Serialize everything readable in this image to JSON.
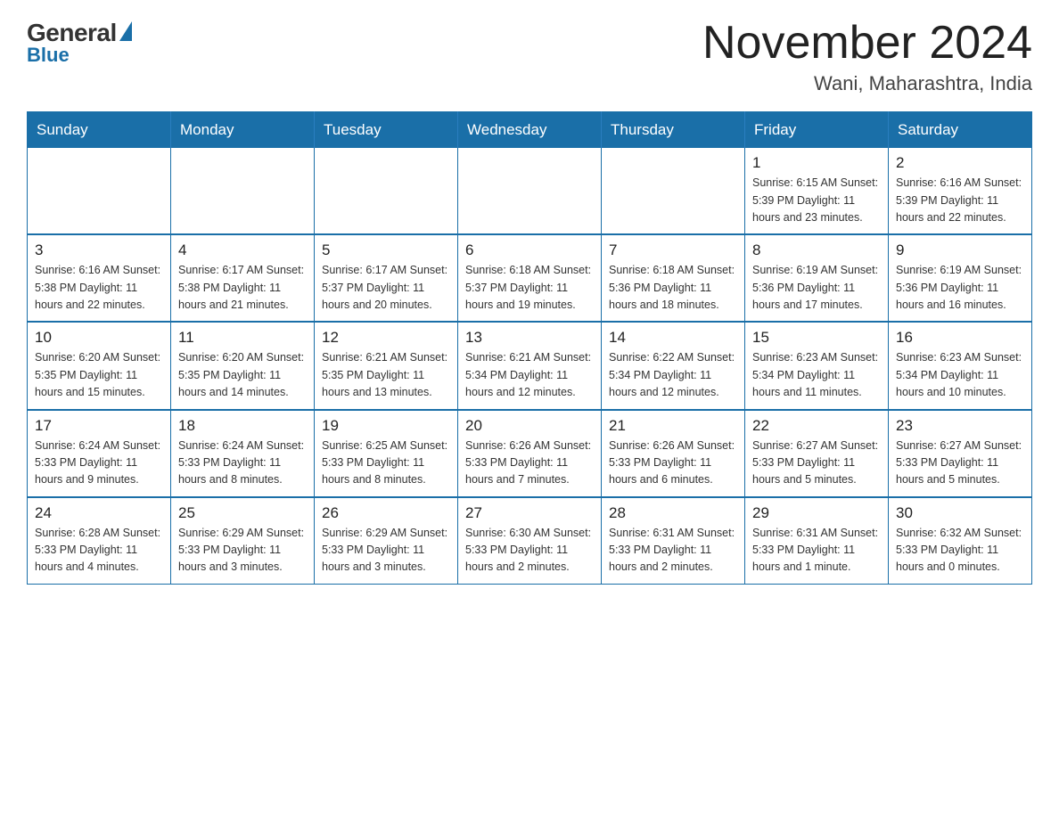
{
  "header": {
    "logo_general": "General",
    "logo_blue": "Blue",
    "month_year": "November 2024",
    "location": "Wani, Maharashtra, India"
  },
  "weekdays": [
    "Sunday",
    "Monday",
    "Tuesday",
    "Wednesday",
    "Thursday",
    "Friday",
    "Saturday"
  ],
  "weeks": [
    [
      {
        "day": "",
        "info": ""
      },
      {
        "day": "",
        "info": ""
      },
      {
        "day": "",
        "info": ""
      },
      {
        "day": "",
        "info": ""
      },
      {
        "day": "",
        "info": ""
      },
      {
        "day": "1",
        "info": "Sunrise: 6:15 AM\nSunset: 5:39 PM\nDaylight: 11 hours\nand 23 minutes."
      },
      {
        "day": "2",
        "info": "Sunrise: 6:16 AM\nSunset: 5:39 PM\nDaylight: 11 hours\nand 22 minutes."
      }
    ],
    [
      {
        "day": "3",
        "info": "Sunrise: 6:16 AM\nSunset: 5:38 PM\nDaylight: 11 hours\nand 22 minutes."
      },
      {
        "day": "4",
        "info": "Sunrise: 6:17 AM\nSunset: 5:38 PM\nDaylight: 11 hours\nand 21 minutes."
      },
      {
        "day": "5",
        "info": "Sunrise: 6:17 AM\nSunset: 5:37 PM\nDaylight: 11 hours\nand 20 minutes."
      },
      {
        "day": "6",
        "info": "Sunrise: 6:18 AM\nSunset: 5:37 PM\nDaylight: 11 hours\nand 19 minutes."
      },
      {
        "day": "7",
        "info": "Sunrise: 6:18 AM\nSunset: 5:36 PM\nDaylight: 11 hours\nand 18 minutes."
      },
      {
        "day": "8",
        "info": "Sunrise: 6:19 AM\nSunset: 5:36 PM\nDaylight: 11 hours\nand 17 minutes."
      },
      {
        "day": "9",
        "info": "Sunrise: 6:19 AM\nSunset: 5:36 PM\nDaylight: 11 hours\nand 16 minutes."
      }
    ],
    [
      {
        "day": "10",
        "info": "Sunrise: 6:20 AM\nSunset: 5:35 PM\nDaylight: 11 hours\nand 15 minutes."
      },
      {
        "day": "11",
        "info": "Sunrise: 6:20 AM\nSunset: 5:35 PM\nDaylight: 11 hours\nand 14 minutes."
      },
      {
        "day": "12",
        "info": "Sunrise: 6:21 AM\nSunset: 5:35 PM\nDaylight: 11 hours\nand 13 minutes."
      },
      {
        "day": "13",
        "info": "Sunrise: 6:21 AM\nSunset: 5:34 PM\nDaylight: 11 hours\nand 12 minutes."
      },
      {
        "day": "14",
        "info": "Sunrise: 6:22 AM\nSunset: 5:34 PM\nDaylight: 11 hours\nand 12 minutes."
      },
      {
        "day": "15",
        "info": "Sunrise: 6:23 AM\nSunset: 5:34 PM\nDaylight: 11 hours\nand 11 minutes."
      },
      {
        "day": "16",
        "info": "Sunrise: 6:23 AM\nSunset: 5:34 PM\nDaylight: 11 hours\nand 10 minutes."
      }
    ],
    [
      {
        "day": "17",
        "info": "Sunrise: 6:24 AM\nSunset: 5:33 PM\nDaylight: 11 hours\nand 9 minutes."
      },
      {
        "day": "18",
        "info": "Sunrise: 6:24 AM\nSunset: 5:33 PM\nDaylight: 11 hours\nand 8 minutes."
      },
      {
        "day": "19",
        "info": "Sunrise: 6:25 AM\nSunset: 5:33 PM\nDaylight: 11 hours\nand 8 minutes."
      },
      {
        "day": "20",
        "info": "Sunrise: 6:26 AM\nSunset: 5:33 PM\nDaylight: 11 hours\nand 7 minutes."
      },
      {
        "day": "21",
        "info": "Sunrise: 6:26 AM\nSunset: 5:33 PM\nDaylight: 11 hours\nand 6 minutes."
      },
      {
        "day": "22",
        "info": "Sunrise: 6:27 AM\nSunset: 5:33 PM\nDaylight: 11 hours\nand 5 minutes."
      },
      {
        "day": "23",
        "info": "Sunrise: 6:27 AM\nSunset: 5:33 PM\nDaylight: 11 hours\nand 5 minutes."
      }
    ],
    [
      {
        "day": "24",
        "info": "Sunrise: 6:28 AM\nSunset: 5:33 PM\nDaylight: 11 hours\nand 4 minutes."
      },
      {
        "day": "25",
        "info": "Sunrise: 6:29 AM\nSunset: 5:33 PM\nDaylight: 11 hours\nand 3 minutes."
      },
      {
        "day": "26",
        "info": "Sunrise: 6:29 AM\nSunset: 5:33 PM\nDaylight: 11 hours\nand 3 minutes."
      },
      {
        "day": "27",
        "info": "Sunrise: 6:30 AM\nSunset: 5:33 PM\nDaylight: 11 hours\nand 2 minutes."
      },
      {
        "day": "28",
        "info": "Sunrise: 6:31 AM\nSunset: 5:33 PM\nDaylight: 11 hours\nand 2 minutes."
      },
      {
        "day": "29",
        "info": "Sunrise: 6:31 AM\nSunset: 5:33 PM\nDaylight: 11 hours\nand 1 minute."
      },
      {
        "day": "30",
        "info": "Sunrise: 6:32 AM\nSunset: 5:33 PM\nDaylight: 11 hours\nand 0 minutes."
      }
    ]
  ]
}
